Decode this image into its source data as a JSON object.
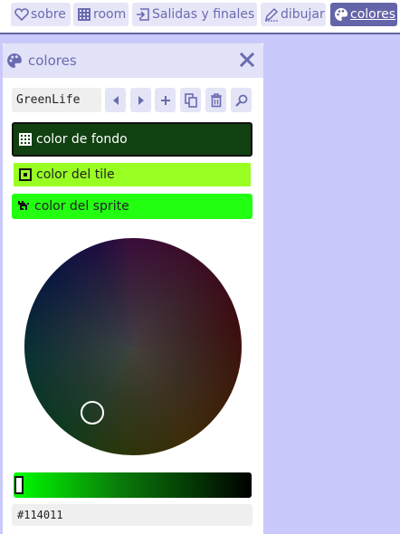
{
  "nav": {
    "tabs": [
      {
        "label": "sobre",
        "icon": "heart-icon",
        "active": false
      },
      {
        "label": "room",
        "icon": "grid-icon",
        "active": false
      },
      {
        "label": "Salidas y finales",
        "icon": "exit-icon",
        "active": false
      },
      {
        "label": "dibujar",
        "icon": "pencil-icon",
        "active": false
      },
      {
        "label": "colores",
        "icon": "palette-icon",
        "active": true
      }
    ]
  },
  "panel": {
    "title": "colores",
    "palette_name": "GreenLife",
    "slots": {
      "background": {
        "label": "color de fondo",
        "color": "#114011"
      },
      "tile": {
        "label": "color del tile",
        "color": "#99ff22"
      },
      "sprite": {
        "label": "color del sprite",
        "color": "#22ff11"
      }
    },
    "hex_value": "#114011"
  },
  "colors": {
    "accent": "#6464a8",
    "nav_tab_bg": "#e6e6f8",
    "page_bg": "#c9c9fb"
  }
}
